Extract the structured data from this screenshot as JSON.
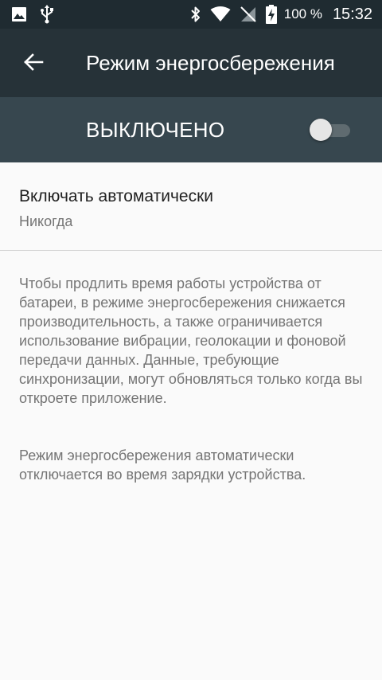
{
  "status_bar": {
    "battery_percent": "100 %",
    "time": "15:32",
    "icons": [
      "image-icon",
      "usb-icon",
      "bluetooth-icon",
      "wifi-icon",
      "no-sim-icon",
      "battery-charging-icon"
    ]
  },
  "app_bar": {
    "title": "Режим энергосбережения",
    "back_icon": "arrow-back-icon"
  },
  "master_switch": {
    "label": "ВЫКЛЮЧЕНО",
    "checked": false
  },
  "auto_enable": {
    "title": "Включать автоматически",
    "summary": "Никогда"
  },
  "info": {
    "paragraph_1": "Чтобы продлить время работы устройства от батареи, в режиме энергосбережения снижается производительность, а также ограничивается использование вибрации, геолокации и фоновой передачи данных. Данные, требующие синхронизации, могут обновляться только когда вы откроете приложение.",
    "paragraph_2": "Режим энергосбережения автоматически отключается во время зарядки устройства."
  },
  "colors": {
    "status_bar": "#1f2b31",
    "app_bar": "#263238",
    "switch_bar": "#37474f",
    "background": "#fafafa"
  }
}
